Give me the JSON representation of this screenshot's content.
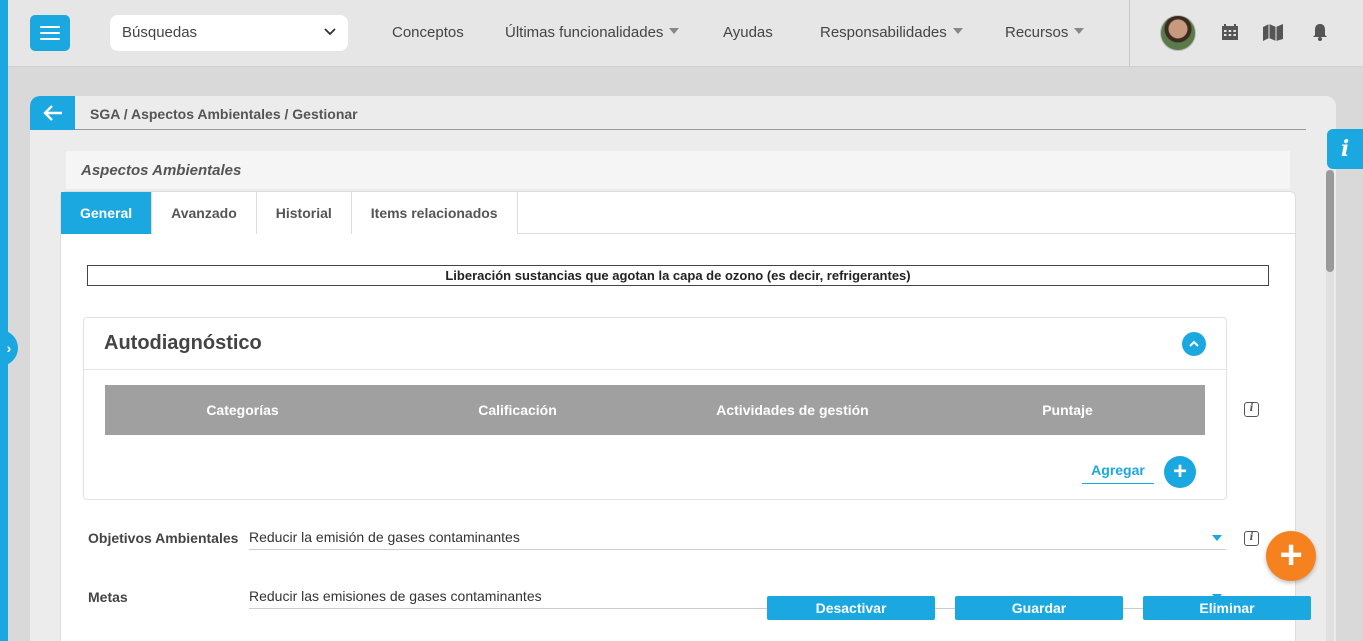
{
  "topbar": {
    "search": {
      "value": "Búsquedas"
    },
    "nav": [
      {
        "label": "Conceptos",
        "has_caret": false
      },
      {
        "label": "Últimas funcionalidades",
        "has_caret": true
      },
      {
        "label": "Ayudas",
        "has_caret": false
      },
      {
        "label": "Responsabilidades",
        "has_caret": true
      },
      {
        "label": "Recursos",
        "has_caret": true
      }
    ],
    "icons": [
      "calendar-icon",
      "map-icon",
      "bell-icon"
    ]
  },
  "breadcrumb": "SGA / Aspectos Ambientales / Gestionar",
  "section_title": "Aspectos Ambientales",
  "tabs": [
    {
      "label": "General",
      "active": true
    },
    {
      "label": "Avanzado",
      "active": false
    },
    {
      "label": "Historial",
      "active": false
    },
    {
      "label": "Items relacionados",
      "active": false
    }
  ],
  "record_title": "Liberación sustancias que agotan la capa de ozono (es decir, refrigerantes)",
  "autodiagnostico": {
    "title": "Autodiagnóstico",
    "columns": [
      "Categorías",
      "Calificación",
      "Actividades de gestión",
      "Puntaje"
    ],
    "add_label": "Agregar"
  },
  "fields": [
    {
      "label": "Objetivos Ambientales",
      "value": "Reducir la emisión de gases contaminantes"
    },
    {
      "label": "Metas",
      "value": "Reducir las emisiones de gases contaminantes"
    }
  ],
  "actions": {
    "deactivate": "Desactivar",
    "save": "Guardar",
    "delete": "Eliminar"
  },
  "colors": {
    "accent": "#1ba8e0",
    "fab": "#f5821f",
    "grid_header": "#a0a0a0"
  }
}
